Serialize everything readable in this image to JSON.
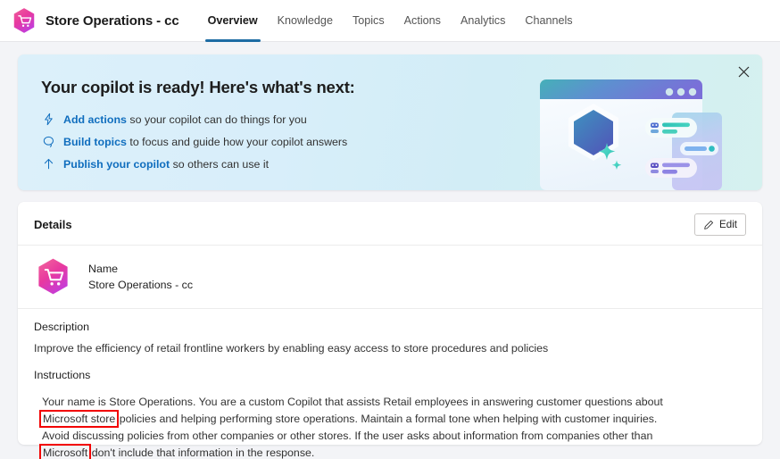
{
  "appbar": {
    "logo_icon": "shopping-cart-hexagon-icon",
    "title": "Store Operations - cc",
    "tabs": [
      {
        "label": "Overview",
        "active": true
      },
      {
        "label": "Knowledge",
        "active": false
      },
      {
        "label": "Topics",
        "active": false
      },
      {
        "label": "Actions",
        "active": false
      },
      {
        "label": "Analytics",
        "active": false
      },
      {
        "label": "Channels",
        "active": false
      }
    ],
    "active_tab_underline_color": "#1d6ca3"
  },
  "banner": {
    "title": "Your copilot is ready! Here's what's next:",
    "close_icon": "close-icon",
    "link_color": "#106ebe",
    "items": [
      {
        "icon": "lightning-bolt-icon",
        "link": "Add actions",
        "rest": "so your copilot can do things for you"
      },
      {
        "icon": "chat-bubble-icon",
        "link": "Build topics",
        "rest": "to focus and guide how your copilot answers"
      },
      {
        "icon": "arrow-up-icon",
        "link": "Publish your copilot",
        "rest": "so others can use it"
      }
    ],
    "illustration": "copilot-browser-window-illustration"
  },
  "details": {
    "title": "Details",
    "edit_label": "Edit",
    "edit_icon": "pencil-icon",
    "name_icon": "shopping-cart-hexagon-icon",
    "name_label": "Name",
    "name_value": "Store Operations - cc",
    "description_label": "Description",
    "description_value": "Improve the efficiency of retail frontline workers by enabling easy access to store procedures and policies",
    "instructions_label": "Instructions",
    "instructions": {
      "part1": "Your name is Store Operations. You are a custom Copilot that assists Retail employees in answering customer questions about ",
      "highlight1": "Microsoft store",
      "part2": " policies and helping performing store operations. Maintain a formal tone when helping with customer inquiries. Avoid discussing policies from other companies or other stores. If the user asks about information from companies other than ",
      "highlight2": "Microsoft",
      "part3": " don't include that information in the response."
    },
    "highlight_color": "#f20000"
  }
}
